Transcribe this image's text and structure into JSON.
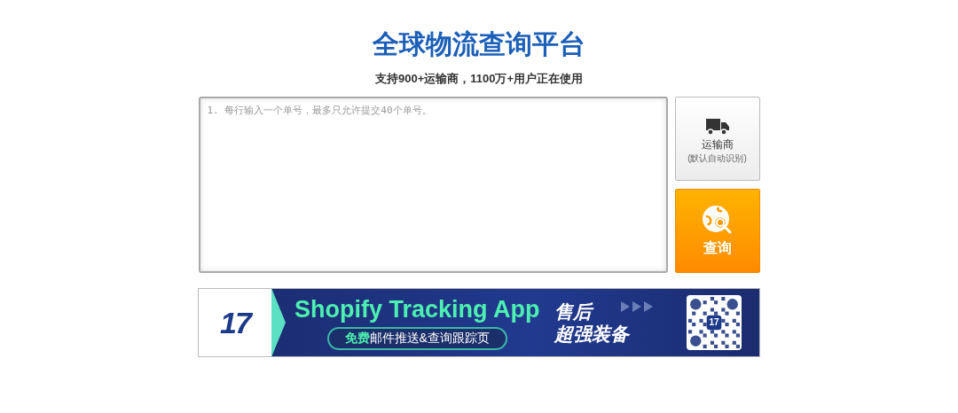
{
  "title": "全球物流查询平台",
  "subtitle": "支持900+运输商，1100万+用户正在使用",
  "tracking_input": {
    "placeholder": "1. 每行输入一个单号，最多只允许提交40个单号。"
  },
  "carrier_button": {
    "label": "运输商",
    "hint": "(默认自动识别)"
  },
  "search_button": {
    "label": "查询"
  },
  "banner": {
    "logo": "17",
    "headline": "Shopify Tracking App",
    "badge_highlight": "免费",
    "badge_text": "邮件推送&查询跟踪页",
    "slogan_1": "售后",
    "slogan_2": "超强装备",
    "qr_logo": "17"
  }
}
